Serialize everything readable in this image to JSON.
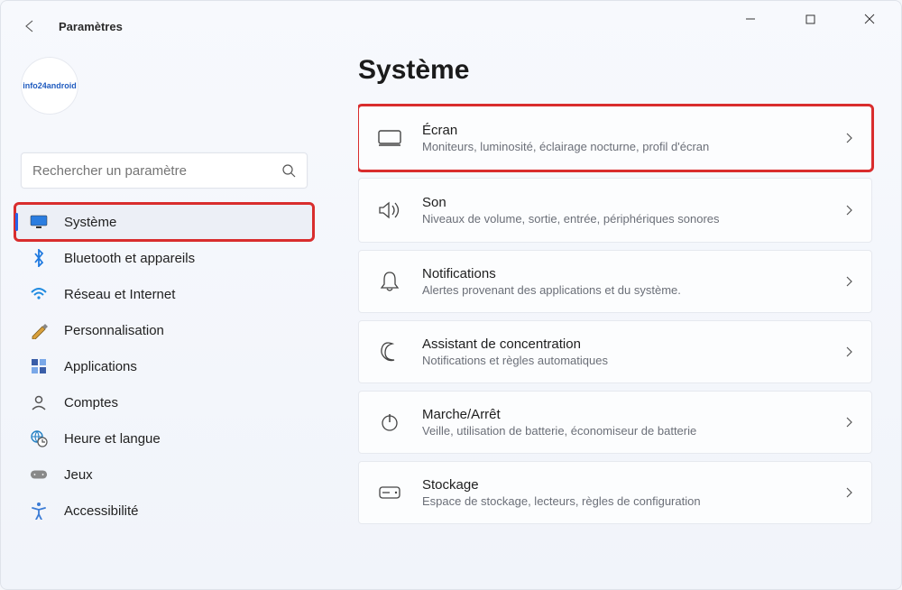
{
  "app_title": "Paramètres",
  "avatar_label": "info24android",
  "search": {
    "placeholder": "Rechercher un paramètre"
  },
  "sidebar": {
    "items": [
      {
        "label": "Système",
        "selected": true,
        "highlight": true,
        "icon": "monitor"
      },
      {
        "label": "Bluetooth et appareils",
        "icon": "bluetooth"
      },
      {
        "label": "Réseau et Internet",
        "icon": "wifi"
      },
      {
        "label": "Personnalisation",
        "icon": "paint"
      },
      {
        "label": "Applications",
        "icon": "apps"
      },
      {
        "label": "Comptes",
        "icon": "user"
      },
      {
        "label": "Heure et langue",
        "icon": "globe-clock"
      },
      {
        "label": "Jeux",
        "icon": "game"
      },
      {
        "label": "Accessibilité",
        "icon": "accessibility"
      }
    ]
  },
  "main": {
    "heading": "Système",
    "panels": [
      {
        "title": "Écran",
        "subtitle": "Moniteurs, luminosité, éclairage nocturne, profil d'écran",
        "icon": "display",
        "highlight": true
      },
      {
        "title": "Son",
        "subtitle": "Niveaux de volume, sortie, entrée, périphériques sonores",
        "icon": "sound"
      },
      {
        "title": "Notifications",
        "subtitle": "Alertes provenant des applications et du système.",
        "icon": "bell"
      },
      {
        "title": "Assistant de concentration",
        "subtitle": "Notifications et règles automatiques",
        "icon": "moon"
      },
      {
        "title": "Marche/Arrêt",
        "subtitle": "Veille, utilisation de batterie, économiseur de batterie",
        "icon": "power"
      },
      {
        "title": "Stockage",
        "subtitle": "Espace de stockage, lecteurs, règles de configuration",
        "icon": "storage"
      }
    ]
  }
}
